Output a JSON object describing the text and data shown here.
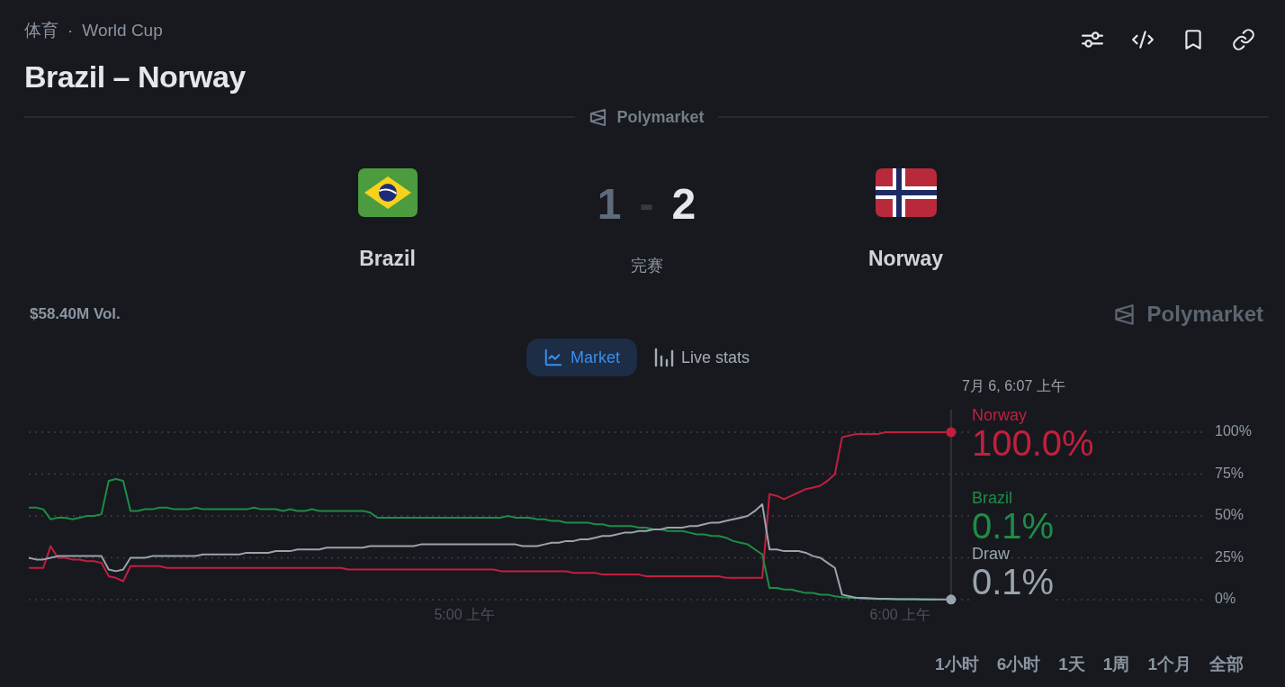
{
  "header": {
    "breadcrumb": {
      "category": "体育",
      "separator": "·",
      "league": "World Cup"
    },
    "title": "Brazil – Norway"
  },
  "source": {
    "label": "Polymarket"
  },
  "match": {
    "teams": [
      {
        "kind": "brazil",
        "name": "Brazil",
        "score": "1",
        "winner": false
      },
      {
        "kind": "norway",
        "name": "Norway",
        "score": "2",
        "winner": true
      }
    ],
    "score_separator": "-",
    "status": "完赛"
  },
  "volume": "$58.40M Vol.",
  "brand": "Polymarket",
  "view_tabs": [
    {
      "kind": "line",
      "label": "Market",
      "selected": true
    },
    {
      "kind": "bars",
      "label": "Live stats",
      "selected": false
    }
  ],
  "chart": {
    "chart_data": {
      "type": "line",
      "grid": true,
      "categories": [
        null,
        null,
        null,
        null,
        null,
        null,
        null,
        null,
        null,
        null,
        null,
        null,
        null,
        null,
        null,
        null,
        null,
        null,
        null,
        null,
        null,
        null,
        null,
        null,
        null,
        null,
        null,
        null,
        null,
        null,
        null,
        null,
        null,
        null,
        null,
        null,
        null,
        null,
        null,
        null,
        null,
        null,
        null,
        null,
        null,
        null,
        null,
        null,
        null,
        null,
        null,
        null,
        null,
        null,
        null,
        null,
        null,
        null,
        null,
        null,
        "5:00 上午",
        null,
        null,
        null,
        null,
        null,
        null,
        null,
        null,
        null,
        null,
        null,
        null,
        null,
        null,
        null,
        null,
        null,
        null,
        null,
        null,
        null,
        null,
        null,
        null,
        null,
        null,
        null,
        null,
        null,
        null,
        null,
        null,
        null,
        null,
        null,
        null,
        null,
        null,
        null,
        null,
        null,
        null,
        null,
        null,
        null,
        null,
        null,
        null,
        null,
        null,
        null,
        null,
        null,
        null,
        null,
        null,
        null,
        null,
        null,
        "6:00 上午",
        null,
        null,
        null,
        null,
        null,
        null,
        null
      ],
      "series": [
        {
          "name": "Norway",
          "color": "#c21f3f",
          "values": [
            19,
            19,
            19,
            32,
            25,
            25,
            24,
            24,
            23,
            23,
            22,
            14,
            13,
            11,
            20,
            20,
            20,
            20,
            20,
            19,
            19,
            19,
            19,
            19,
            19,
            19,
            19,
            19,
            19,
            19,
            19,
            19,
            19,
            19,
            19,
            19,
            19,
            19,
            19,
            19,
            19,
            19,
            19,
            19,
            18,
            18,
            18,
            18,
            18,
            18,
            18,
            18,
            18,
            18,
            18,
            18,
            18,
            18,
            18,
            18,
            18,
            18,
            18,
            18,
            18,
            17,
            17,
            17,
            17,
            17,
            17,
            17,
            17,
            17,
            17,
            16,
            16,
            16,
            16,
            15,
            15,
            15,
            15,
            15,
            15,
            14,
            14,
            14,
            14,
            14,
            14,
            14,
            14,
            14,
            14,
            14,
            13,
            13,
            13,
            13,
            13,
            13,
            63,
            62,
            60,
            62,
            64,
            66,
            67,
            68,
            71,
            75,
            97,
            98,
            99,
            99,
            99,
            99,
            100,
            100,
            100,
            100,
            100,
            100,
            100,
            100,
            100,
            100
          ]
        },
        {
          "name": "Brazil",
          "color": "#1f8c47",
          "values": [
            55,
            55,
            54,
            48,
            49,
            49,
            48,
            49,
            50,
            50,
            51,
            71,
            72,
            71,
            53,
            53,
            54,
            54,
            55,
            55,
            54,
            54,
            54,
            55,
            54,
            54,
            54,
            54,
            54,
            54,
            54,
            55,
            54,
            54,
            54,
            53,
            54,
            53,
            53,
            54,
            53,
            53,
            53,
            53,
            53,
            53,
            53,
            52,
            49,
            49,
            49,
            49,
            49,
            49,
            49,
            49,
            49,
            49,
            49,
            49,
            49,
            49,
            49,
            49,
            49,
            49,
            50,
            49,
            49,
            49,
            48,
            48,
            47,
            47,
            46,
            46,
            46,
            46,
            45,
            45,
            44,
            44,
            44,
            44,
            43,
            43,
            42,
            42,
            41,
            41,
            41,
            40,
            39,
            39,
            38,
            38,
            37,
            35,
            34,
            33,
            30,
            27,
            7,
            7,
            6,
            6,
            5,
            4,
            4,
            3,
            3,
            2,
            1.5,
            1,
            1,
            0.5,
            0.5,
            0.4,
            0.4,
            0.3,
            0.3,
            0.2,
            0.2,
            0.2,
            0.1,
            0.1,
            null,
            null
          ]
        },
        {
          "name": "Draw",
          "color": "#9aa4ae",
          "values": [
            25,
            24,
            24,
            25,
            26,
            26,
            26,
            26,
            26,
            26,
            26,
            18,
            17,
            18,
            25,
            25,
            25,
            26,
            26,
            26,
            26,
            26,
            26,
            26,
            27,
            27,
            27,
            27,
            27,
            27,
            28,
            28,
            28,
            28,
            29,
            29,
            29,
            30,
            30,
            30,
            30,
            31,
            31,
            31,
            31,
            31,
            31,
            32,
            32,
            32,
            32,
            32,
            32,
            32,
            33,
            33,
            33,
            33,
            33,
            33,
            33,
            33,
            33,
            33,
            33,
            33,
            33,
            33,
            32,
            32,
            32,
            33,
            34,
            34,
            35,
            35,
            36,
            36,
            37,
            38,
            38,
            39,
            40,
            40,
            41,
            41,
            42,
            42,
            43,
            43,
            43,
            44,
            44,
            45,
            46,
            46,
            47,
            48,
            49,
            50,
            53,
            57,
            30,
            30,
            29,
            29,
            29,
            28,
            26,
            25,
            22,
            19,
            3,
            2,
            1,
            1,
            0.8,
            0.6,
            0.5,
            0.4,
            0.3,
            0.2,
            0.2,
            0.1,
            0.1,
            0.1,
            0.1,
            0.1
          ]
        }
      ],
      "ylim": [
        0,
        100
      ],
      "yticks": [
        {
          "value": 100,
          "label": "100%"
        },
        {
          "value": 75,
          "label": "75%"
        },
        {
          "value": 50,
          "label": "50%"
        },
        {
          "value": 25,
          "label": "25%"
        },
        {
          "value": 0,
          "label": "0%"
        }
      ]
    },
    "tooltip": {
      "time": "7月 6, 6:07 上午",
      "values": [
        "100.0%",
        "0.1%",
        "0.1%"
      ]
    }
  },
  "ranges": [
    {
      "label": "1小时",
      "selected": false
    },
    {
      "label": "6小时",
      "selected": false
    },
    {
      "label": "1天",
      "selected": false
    },
    {
      "label": "1周",
      "selected": false
    },
    {
      "label": "1个月",
      "selected": false
    },
    {
      "label": "全部",
      "selected": false
    }
  ]
}
